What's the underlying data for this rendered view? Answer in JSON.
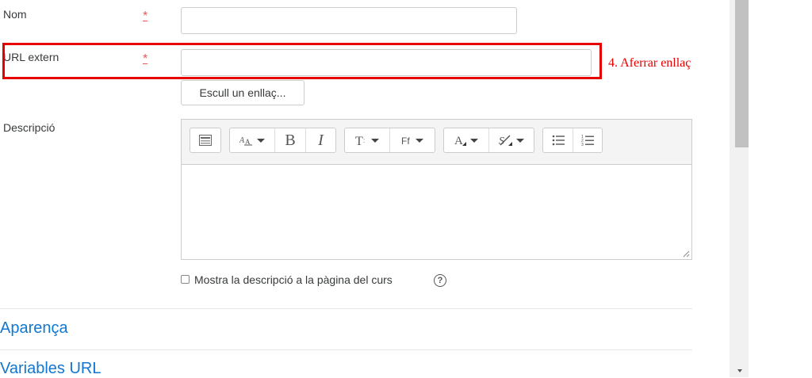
{
  "form": {
    "name_label": "Nom",
    "url_label": "URL extern",
    "required_mark": "*",
    "choose_link_button": "Escull un enllaç...",
    "description_label": "Descripció",
    "show_description_label": "Mostra la descripció a la pàgina del curs",
    "help_mark": "?"
  },
  "annotation": {
    "text": "4. Aferrar enllaç",
    "color": "#e60000"
  },
  "sections": {
    "appearance": "Aparença",
    "url_variables": "Variables URL"
  },
  "toolbar": {
    "bold": "B",
    "italic": "I",
    "icons": [
      "show-more-buttons-icon",
      "font-size-icon",
      "bold-icon",
      "italic-icon",
      "paragraph-style-icon",
      "font-family-icon",
      "text-color-icon",
      "highlight-color-icon",
      "unordered-list-icon",
      "ordered-list-icon"
    ]
  },
  "colors": {
    "required": "#e45b5b",
    "link": "#1177d1",
    "highlight": "#e60000"
  }
}
